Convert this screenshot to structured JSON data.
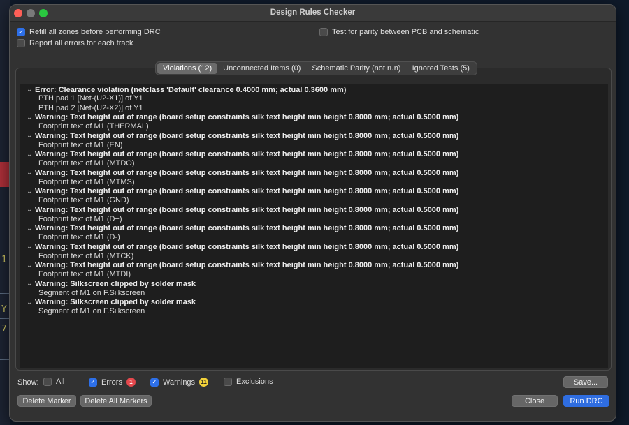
{
  "window": {
    "title": "Design Rules Checker"
  },
  "options": {
    "refill_zones": {
      "label": "Refill all zones before performing DRC",
      "checked": true
    },
    "report_all_errors": {
      "label": "Report all errors for each track",
      "checked": false
    },
    "test_parity": {
      "label": "Test for parity between PCB and schematic",
      "checked": false
    }
  },
  "tabs": [
    {
      "label": "Violations (12)",
      "active": true
    },
    {
      "label": "Unconnected Items (0)",
      "active": false
    },
    {
      "label": "Schematic Parity (not run)",
      "active": false
    },
    {
      "label": "Ignored Tests (5)",
      "active": false
    }
  ],
  "violations": [
    {
      "title": "Error: Clearance violation (netclass 'Default' clearance 0.4000 mm; actual 0.3600 mm)",
      "items": [
        "PTH pad 1 [Net-(U2-X1)] of Y1",
        "PTH pad 2 [Net-(U2-X2)] of Y1"
      ]
    },
    {
      "title": "Warning: Text height out of range (board setup constraints silk text height min height 0.8000 mm; actual 0.5000 mm)",
      "items": [
        "Footprint text of M1 (THERMAL)"
      ]
    },
    {
      "title": "Warning: Text height out of range (board setup constraints silk text height min height 0.8000 mm; actual 0.5000 mm)",
      "items": [
        "Footprint text of M1 (EN)"
      ]
    },
    {
      "title": "Warning: Text height out of range (board setup constraints silk text height min height 0.8000 mm; actual 0.5000 mm)",
      "items": [
        "Footprint text of M1 (MTDO)"
      ]
    },
    {
      "title": "Warning: Text height out of range (board setup constraints silk text height min height 0.8000 mm; actual 0.5000 mm)",
      "items": [
        "Footprint text of M1 (MTMS)"
      ]
    },
    {
      "title": "Warning: Text height out of range (board setup constraints silk text height min height 0.8000 mm; actual 0.5000 mm)",
      "items": [
        "Footprint text of M1 (GND)"
      ]
    },
    {
      "title": "Warning: Text height out of range (board setup constraints silk text height min height 0.8000 mm; actual 0.5000 mm)",
      "items": [
        "Footprint text of M1 (D+)"
      ]
    },
    {
      "title": "Warning: Text height out of range (board setup constraints silk text height min height 0.8000 mm; actual 0.5000 mm)",
      "items": [
        "Footprint text of M1 (D-)"
      ]
    },
    {
      "title": "Warning: Text height out of range (board setup constraints silk text height min height 0.8000 mm; actual 0.5000 mm)",
      "items": [
        "Footprint text of M1 (MTCK)"
      ]
    },
    {
      "title": "Warning: Text height out of range (board setup constraints silk text height min height 0.8000 mm; actual 0.5000 mm)",
      "items": [
        "Footprint text of M1 (MTDI)"
      ]
    },
    {
      "title": "Warning: Silkscreen clipped by solder mask",
      "items": [
        "Segment of M1 on F.Silkscreen"
      ]
    },
    {
      "title": "Warning: Silkscreen clipped by solder mask",
      "items": [
        "Segment of M1 on F.Silkscreen"
      ]
    }
  ],
  "filters": {
    "show_label": "Show:",
    "all": {
      "label": "All",
      "checked": false
    },
    "errors": {
      "label": "Errors",
      "checked": true,
      "count": "1"
    },
    "warnings": {
      "label": "Warnings",
      "checked": true,
      "count": "11"
    },
    "exclusions": {
      "label": "Exclusions",
      "checked": false
    }
  },
  "buttons": {
    "save": "Save...",
    "delete_marker": "Delete Marker",
    "delete_all_markers": "Delete All Markers",
    "close": "Close",
    "run_drc": "Run DRC"
  },
  "background": {
    "chars": [
      "1",
      "Y",
      "7"
    ]
  },
  "colors": {
    "accent": "#2f6de0",
    "error_badge": "#e5484d",
    "warning_badge": "#f2d13a",
    "close_button": "#fe5f57",
    "zoom_button": "#2ac840"
  }
}
